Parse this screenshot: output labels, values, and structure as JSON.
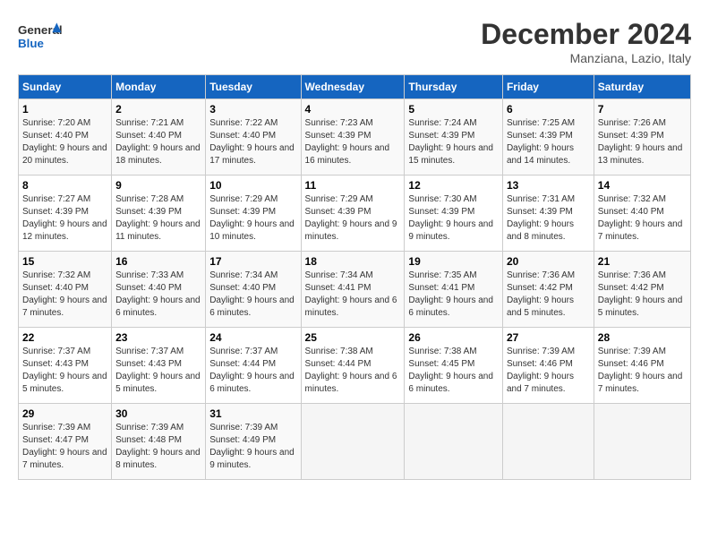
{
  "logo": {
    "general": "General",
    "blue": "Blue"
  },
  "title": "December 2024",
  "location": "Manziana, Lazio, Italy",
  "days_of_week": [
    "Sunday",
    "Monday",
    "Tuesday",
    "Wednesday",
    "Thursday",
    "Friday",
    "Saturday"
  ],
  "weeks": [
    [
      {
        "day": "1",
        "sunrise": "Sunrise: 7:20 AM",
        "sunset": "Sunset: 4:40 PM",
        "daylight": "Daylight: 9 hours and 20 minutes."
      },
      {
        "day": "2",
        "sunrise": "Sunrise: 7:21 AM",
        "sunset": "Sunset: 4:40 PM",
        "daylight": "Daylight: 9 hours and 18 minutes."
      },
      {
        "day": "3",
        "sunrise": "Sunrise: 7:22 AM",
        "sunset": "Sunset: 4:40 PM",
        "daylight": "Daylight: 9 hours and 17 minutes."
      },
      {
        "day": "4",
        "sunrise": "Sunrise: 7:23 AM",
        "sunset": "Sunset: 4:39 PM",
        "daylight": "Daylight: 9 hours and 16 minutes."
      },
      {
        "day": "5",
        "sunrise": "Sunrise: 7:24 AM",
        "sunset": "Sunset: 4:39 PM",
        "daylight": "Daylight: 9 hours and 15 minutes."
      },
      {
        "day": "6",
        "sunrise": "Sunrise: 7:25 AM",
        "sunset": "Sunset: 4:39 PM",
        "daylight": "Daylight: 9 hours and 14 minutes."
      },
      {
        "day": "7",
        "sunrise": "Sunrise: 7:26 AM",
        "sunset": "Sunset: 4:39 PM",
        "daylight": "Daylight: 9 hours and 13 minutes."
      }
    ],
    [
      {
        "day": "8",
        "sunrise": "Sunrise: 7:27 AM",
        "sunset": "Sunset: 4:39 PM",
        "daylight": "Daylight: 9 hours and 12 minutes."
      },
      {
        "day": "9",
        "sunrise": "Sunrise: 7:28 AM",
        "sunset": "Sunset: 4:39 PM",
        "daylight": "Daylight: 9 hours and 11 minutes."
      },
      {
        "day": "10",
        "sunrise": "Sunrise: 7:29 AM",
        "sunset": "Sunset: 4:39 PM",
        "daylight": "Daylight: 9 hours and 10 minutes."
      },
      {
        "day": "11",
        "sunrise": "Sunrise: 7:29 AM",
        "sunset": "Sunset: 4:39 PM",
        "daylight": "Daylight: 9 hours and 9 minutes."
      },
      {
        "day": "12",
        "sunrise": "Sunrise: 7:30 AM",
        "sunset": "Sunset: 4:39 PM",
        "daylight": "Daylight: 9 hours and 9 minutes."
      },
      {
        "day": "13",
        "sunrise": "Sunrise: 7:31 AM",
        "sunset": "Sunset: 4:39 PM",
        "daylight": "Daylight: 9 hours and 8 minutes."
      },
      {
        "day": "14",
        "sunrise": "Sunrise: 7:32 AM",
        "sunset": "Sunset: 4:40 PM",
        "daylight": "Daylight: 9 hours and 7 minutes."
      }
    ],
    [
      {
        "day": "15",
        "sunrise": "Sunrise: 7:32 AM",
        "sunset": "Sunset: 4:40 PM",
        "daylight": "Daylight: 9 hours and 7 minutes."
      },
      {
        "day": "16",
        "sunrise": "Sunrise: 7:33 AM",
        "sunset": "Sunset: 4:40 PM",
        "daylight": "Daylight: 9 hours and 6 minutes."
      },
      {
        "day": "17",
        "sunrise": "Sunrise: 7:34 AM",
        "sunset": "Sunset: 4:40 PM",
        "daylight": "Daylight: 9 hours and 6 minutes."
      },
      {
        "day": "18",
        "sunrise": "Sunrise: 7:34 AM",
        "sunset": "Sunset: 4:41 PM",
        "daylight": "Daylight: 9 hours and 6 minutes."
      },
      {
        "day": "19",
        "sunrise": "Sunrise: 7:35 AM",
        "sunset": "Sunset: 4:41 PM",
        "daylight": "Daylight: 9 hours and 6 minutes."
      },
      {
        "day": "20",
        "sunrise": "Sunrise: 7:36 AM",
        "sunset": "Sunset: 4:42 PM",
        "daylight": "Daylight: 9 hours and 5 minutes."
      },
      {
        "day": "21",
        "sunrise": "Sunrise: 7:36 AM",
        "sunset": "Sunset: 4:42 PM",
        "daylight": "Daylight: 9 hours and 5 minutes."
      }
    ],
    [
      {
        "day": "22",
        "sunrise": "Sunrise: 7:37 AM",
        "sunset": "Sunset: 4:43 PM",
        "daylight": "Daylight: 9 hours and 5 minutes."
      },
      {
        "day": "23",
        "sunrise": "Sunrise: 7:37 AM",
        "sunset": "Sunset: 4:43 PM",
        "daylight": "Daylight: 9 hours and 5 minutes."
      },
      {
        "day": "24",
        "sunrise": "Sunrise: 7:37 AM",
        "sunset": "Sunset: 4:44 PM",
        "daylight": "Daylight: 9 hours and 6 minutes."
      },
      {
        "day": "25",
        "sunrise": "Sunrise: 7:38 AM",
        "sunset": "Sunset: 4:44 PM",
        "daylight": "Daylight: 9 hours and 6 minutes."
      },
      {
        "day": "26",
        "sunrise": "Sunrise: 7:38 AM",
        "sunset": "Sunset: 4:45 PM",
        "daylight": "Daylight: 9 hours and 6 minutes."
      },
      {
        "day": "27",
        "sunrise": "Sunrise: 7:39 AM",
        "sunset": "Sunset: 4:46 PM",
        "daylight": "Daylight: 9 hours and 7 minutes."
      },
      {
        "day": "28",
        "sunrise": "Sunrise: 7:39 AM",
        "sunset": "Sunset: 4:46 PM",
        "daylight": "Daylight: 9 hours and 7 minutes."
      }
    ],
    [
      {
        "day": "29",
        "sunrise": "Sunrise: 7:39 AM",
        "sunset": "Sunset: 4:47 PM",
        "daylight": "Daylight: 9 hours and 7 minutes."
      },
      {
        "day": "30",
        "sunrise": "Sunrise: 7:39 AM",
        "sunset": "Sunset: 4:48 PM",
        "daylight": "Daylight: 9 hours and 8 minutes."
      },
      {
        "day": "31",
        "sunrise": "Sunrise: 7:39 AM",
        "sunset": "Sunset: 4:49 PM",
        "daylight": "Daylight: 9 hours and 9 minutes."
      },
      null,
      null,
      null,
      null
    ]
  ]
}
